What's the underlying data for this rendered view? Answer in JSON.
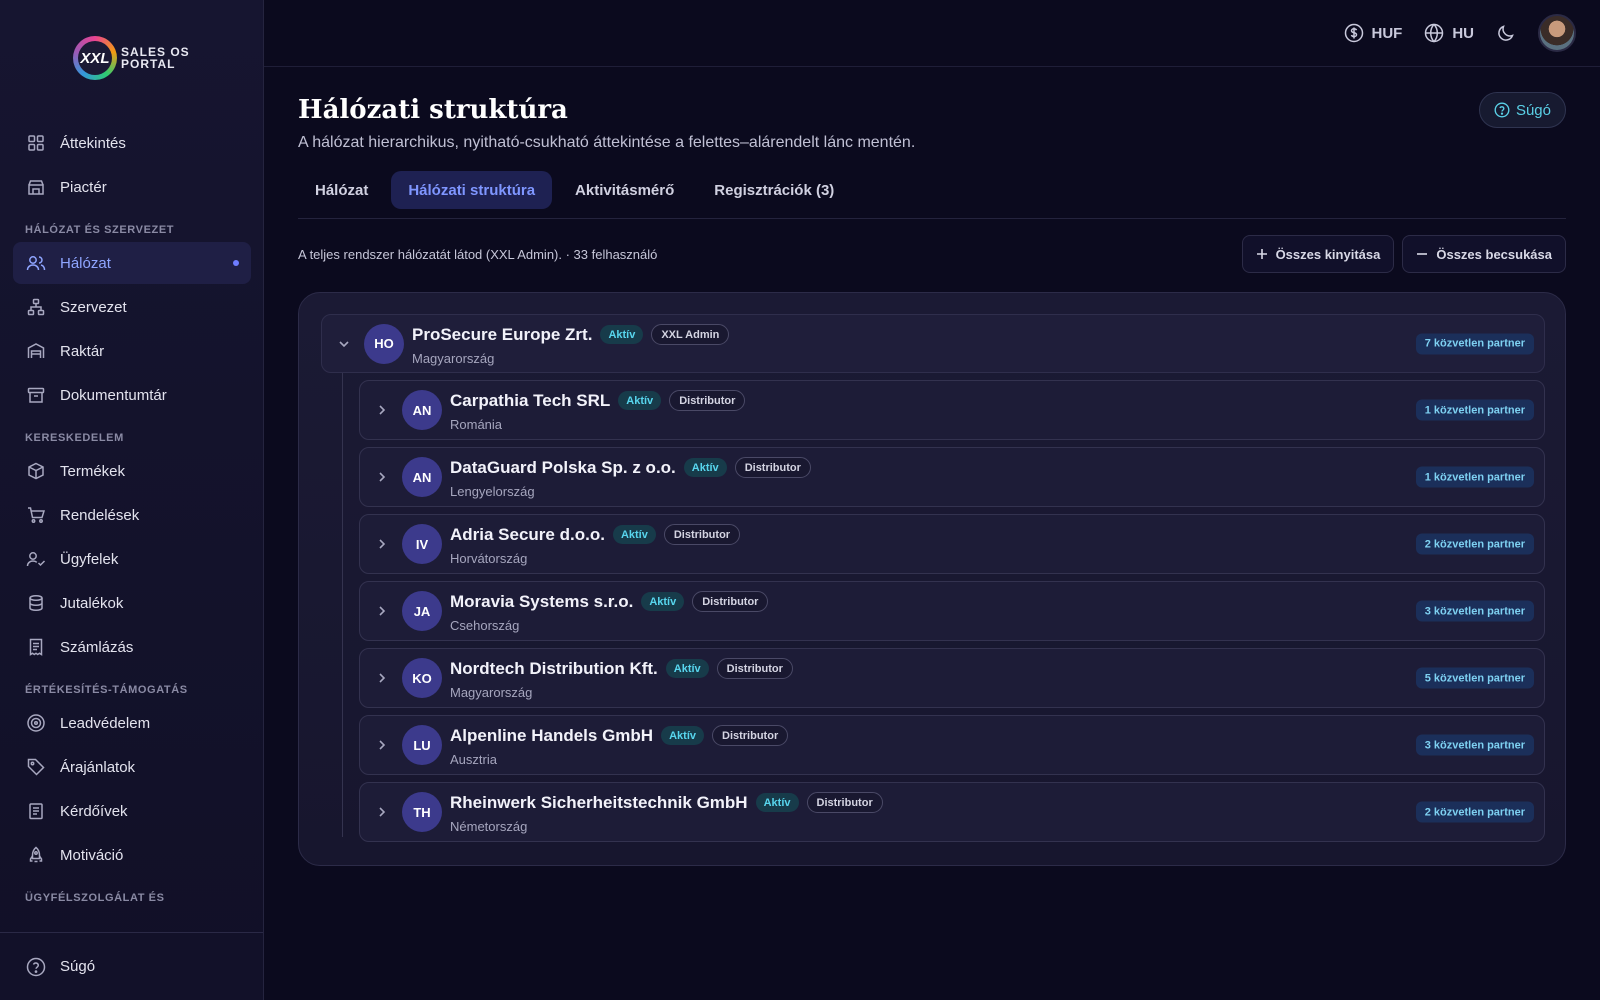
{
  "brand": {
    "logo_mark": "XXL",
    "logo_line1": "SALES OS",
    "logo_line2": "PORTAL"
  },
  "sidebar": {
    "top_items": [
      {
        "label": "Áttekintés",
        "icon": "grid-icon"
      },
      {
        "label": "Piactér",
        "icon": "store-icon"
      }
    ],
    "sections": [
      {
        "title": "HÁLÓZAT ÉS SZERVEZET",
        "items": [
          {
            "label": "Hálózat",
            "icon": "users-icon",
            "active": true
          },
          {
            "label": "Szervezet",
            "icon": "org-chart-icon"
          },
          {
            "label": "Raktár",
            "icon": "warehouse-icon"
          },
          {
            "label": "Dokumentumtár",
            "icon": "archive-icon"
          }
        ]
      },
      {
        "title": "KERESKEDELEM",
        "items": [
          {
            "label": "Termékek",
            "icon": "box-icon"
          },
          {
            "label": "Rendelések",
            "icon": "cart-icon"
          },
          {
            "label": "Ügyfelek",
            "icon": "user-check-icon"
          },
          {
            "label": "Jutalékok",
            "icon": "database-icon"
          },
          {
            "label": "Számlázás",
            "icon": "receipt-icon"
          }
        ]
      },
      {
        "title": "ÉRTÉKESÍTÉS-TÁMOGATÁS",
        "items": [
          {
            "label": "Leadvédelem",
            "icon": "target-icon"
          },
          {
            "label": "Árajánlatok",
            "icon": "tag-icon"
          },
          {
            "label": "Kérdőívek",
            "icon": "clipboard-icon"
          },
          {
            "label": "Motiváció",
            "icon": "rocket-icon"
          }
        ]
      },
      {
        "title": "ÜGYFÉLSZOLGÁLAT ÉS"
      }
    ],
    "footer_label": "Súgó"
  },
  "topbar": {
    "currency": "HUF",
    "language": "HU"
  },
  "page": {
    "title": "Hálózati struktúra",
    "subtitle": "A hálózat hierarchikus, nyitható-csukható áttekintése a felettes–alárendelt lánc mentén.",
    "help_label": "Súgó",
    "tabs": [
      {
        "label": "Hálózat"
      },
      {
        "label": "Hálózati struktúra",
        "active": true
      },
      {
        "label": "Aktivitásmérő"
      },
      {
        "label": "Regisztrációk (3)"
      }
    ],
    "info": "A teljes rendszer hálózatát látod (XXL Admin). · 33 felhasználó",
    "expand_all": "Összes kinyitása",
    "collapse_all": "Összes becsukása"
  },
  "tree": {
    "root": {
      "initials": "HO",
      "name": "ProSecure Europe Zrt.",
      "status": "Aktív",
      "role": "XXL Admin",
      "country": "Magyarország",
      "partners": "7 közvetlen partner"
    },
    "children": [
      {
        "initials": "AN",
        "name": "Carpathia Tech SRL",
        "status": "Aktív",
        "role": "Distributor",
        "country": "Románia",
        "partners": "1 közvetlen partner"
      },
      {
        "initials": "AN",
        "name": "DataGuard Polska Sp. z o.o.",
        "status": "Aktív",
        "role": "Distributor",
        "country": "Lengyelország",
        "partners": "1 közvetlen partner"
      },
      {
        "initials": "IV",
        "name": "Adria Secure d.o.o.",
        "status": "Aktív",
        "role": "Distributor",
        "country": "Horvátország",
        "partners": "2 közvetlen partner"
      },
      {
        "initials": "JA",
        "name": "Moravia Systems s.r.o.",
        "status": "Aktív",
        "role": "Distributor",
        "country": "Csehország",
        "partners": "3 közvetlen partner"
      },
      {
        "initials": "KO",
        "name": "Nordtech Distribution Kft.",
        "status": "Aktív",
        "role": "Distributor",
        "country": "Magyarország",
        "partners": "5 közvetlen partner"
      },
      {
        "initials": "LU",
        "name": "Alpenline Handels GmbH",
        "status": "Aktív",
        "role": "Distributor",
        "country": "Ausztria",
        "partners": "3 közvetlen partner"
      },
      {
        "initials": "TH",
        "name": "Rheinwerk Sicherheitstechnik GmbH",
        "status": "Aktív",
        "role": "Distributor",
        "country": "Németország",
        "partners": "2 közvetlen partner"
      }
    ]
  }
}
